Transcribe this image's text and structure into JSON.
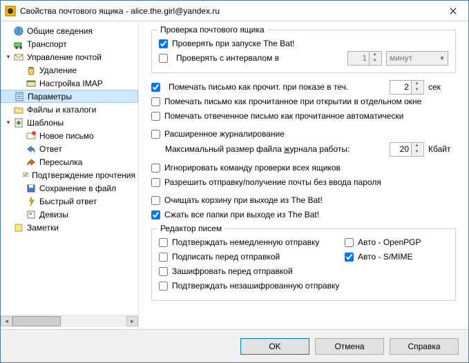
{
  "window": {
    "title": "Свойства почтового ящика - alice.the.girl@yandex.ru"
  },
  "tree": {
    "general": "Общие сведения",
    "transport": "Транспорт",
    "mail_mgmt": "Управление почтой",
    "deletion": "Удаление",
    "imap": "Настройка IMAP",
    "params": "Параметры",
    "files": "Файлы и каталоги",
    "templates": "Шаблоны",
    "new_msg": "Новое письмо",
    "reply": "Ответ",
    "forward": "Пересылка",
    "read_confirm": "Подтверждение прочтения",
    "save_file": "Сохранение в файл",
    "quick_reply": "Быстрый ответ",
    "mottos": "Девизы",
    "notes": "Заметки"
  },
  "check": {
    "legend": "Проверка почтового ящика",
    "at_start": "Проверять при запуске The Bat!",
    "interval": "Проверять с интервалом в",
    "interval_val": "1",
    "interval_unit": "минут"
  },
  "opts": {
    "mark_read_show": "Помечать письмо как прочит. при показе в теч.",
    "mark_read_show_val": "2",
    "mark_read_show_unit": "сек",
    "mark_read_open": "Помечать письмо как прочитанное при открытии в отдельном окне",
    "mark_replied": "Помечать отвеченное письмо как прочитанное автоматически",
    "ext_journal": "Расширенное журналирование",
    "journal_size_lbl": "Максимальный размер файла журнала работы:",
    "journal_size_val": "20",
    "journal_size_unit": "Кбайт",
    "ignore_checkall": "Игнорировать команду проверки всех ящиков",
    "allow_nopass": "Разрешить отправку/получение почты без ввода пароля",
    "empty_trash": "Очищать корзину при выходе из The Bat!",
    "compact": "Сжать все папки при выходе из The Bat!"
  },
  "editor": {
    "legend": "Редактор писем",
    "confirm_immediate": "Подтверждать немедленную отправку",
    "sign": "Подписать перед отправкой",
    "encrypt": "Зашифровать перед отправкой",
    "confirm_unenc": "Подтверждать незашифрованную отправку",
    "auto_pgp": "Авто - OpenPGP",
    "auto_smime": "Авто - S/MIME"
  },
  "buttons": {
    "ok": "OK",
    "cancel": "Отмена",
    "help": "Справка"
  }
}
